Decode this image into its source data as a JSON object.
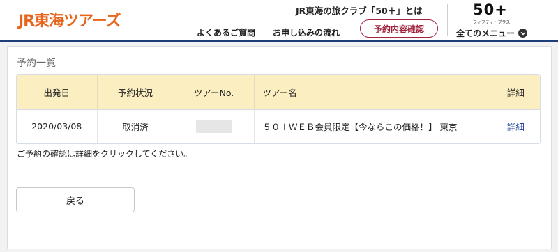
{
  "header": {
    "logo": "JR東海ツアーズ",
    "club_link": "JR東海の旅クラブ「50＋」とは",
    "faq_link": "よくあるご質問",
    "flow_link": "お申し込みの流れ",
    "confirm_button": "予約内容確認",
    "brand_mark": "50+",
    "brand_sub": "フィフティ・プラス",
    "menu_link": "全てのメニュー",
    "logo_color": "#e8641b",
    "accent_color": "#a0243d",
    "nav_border_color": "#1c3f7a"
  },
  "main": {
    "title": "予約一覧",
    "table": {
      "headers": [
        "出発日",
        "予約状況",
        "ツアーNo.",
        "ツアー名",
        "詳細"
      ],
      "rows": [
        {
          "date": "2020/03/08",
          "status": "取消済",
          "tour_no": "",
          "tour_name": "５０＋ＷＥＢ会員限定【今ならこの価格！】 東京",
          "detail": "詳細"
        }
      ]
    },
    "note": "ご予約の確認は詳細をクリックしてください。",
    "back_button": "戻る"
  }
}
